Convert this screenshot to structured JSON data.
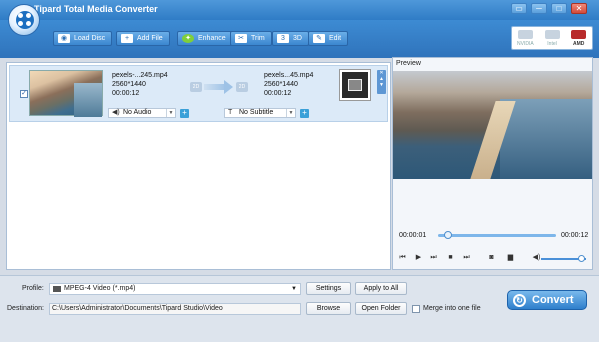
{
  "window": {
    "title": "Tipard Total Media Converter",
    "controls": [
      "▭",
      "─",
      "□",
      "✕"
    ]
  },
  "toolbar": {
    "load_disc": "Load Disc",
    "add_file": "Add File",
    "enhance": "Enhance",
    "trim": "Trim",
    "three_d": "3D",
    "edit": "Edit",
    "gpu": [
      {
        "label": "NVIDIA",
        "active": false
      },
      {
        "label": "Intel",
        "active": false
      },
      {
        "label": "AMD",
        "active": true
      }
    ],
    "gpu_active_color": "#b82b2b"
  },
  "file": {
    "checked": true,
    "source": {
      "name": "pexels-...245.mp4",
      "resolution": "2560*1440",
      "duration": "00:00:12"
    },
    "output": {
      "name": "pexels...45.mp4",
      "resolution": "2560*1440",
      "duration": "00:00:12"
    },
    "audio": "No Audio",
    "subtitle": "No Subtitle"
  },
  "preview": {
    "label": "Preview",
    "current_time": "00:00:01",
    "total_time": "00:00:12",
    "progress": 0.083,
    "volume": 0.9
  },
  "bottom": {
    "profile_label": "Profile:",
    "profile_value": "MPEG-4 Video (*.mp4)",
    "settings": "Settings",
    "apply_all": "Apply to All",
    "destination_label": "Destination:",
    "destination_value": "C:\\Users\\Administrator\\Documents\\Tipard Studio\\Video",
    "browse": "Browse",
    "open_folder": "Open Folder",
    "merge_label": "Merge into one file",
    "merge_checked": false,
    "convert": "Convert"
  },
  "colors": {
    "accent": "#2f7cc6",
    "selection": "#dceaf8",
    "track": "#7db6ea"
  }
}
